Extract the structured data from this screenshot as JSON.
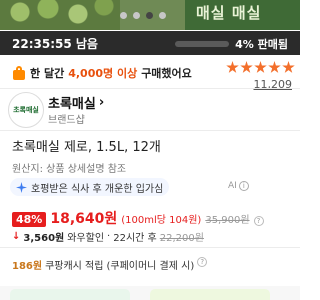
{
  "banner": {
    "text": "매실 매실",
    "carousel_dots": 4,
    "active_dot": 3
  },
  "timer": {
    "countdown": "22:35:55 남음",
    "sold_label": "4% 판매됨",
    "sold_fraction": 0.04
  },
  "social_proof": {
    "icon": "shopping-bag-icon",
    "prefix": "한 달간",
    "count": "4,000명 이상",
    "suffix": "구매했어요"
  },
  "rating": {
    "stars": 5,
    "review_count": "11,209"
  },
  "brand": {
    "logo_text": "초록매실",
    "name": "초록매실",
    "chevron": "›",
    "sub": "브랜드샵"
  },
  "product": {
    "title": "초록매실 제로, 1.5L, 12개",
    "origin": "원산지: 상품 상세설명 참조"
  },
  "ai_summary": {
    "icon": "sparkle-icon",
    "text": "호평받은 식사 후 개운한 입가심",
    "tag": "AI",
    "info_icon": "i"
  },
  "price": {
    "discount": "48%",
    "value": "18,640원",
    "unit_price": "(100ml당 104원)",
    "original": "35,900원",
    "q": "?"
  },
  "wow": {
    "arrow": "↓",
    "amount": "3,560원",
    "label": "와우할인",
    "separator": "·",
    "period": "22시간 후",
    "original": "22,200원"
  },
  "cash": {
    "amount": "186원",
    "label": "쿠팡캐시 적립",
    "note": "(쿠페이머니 결제 시)",
    "q": "?"
  },
  "colors": {
    "accent_red": "#e61e1e",
    "star_orange": "#f36f2b",
    "cash_gold": "#c9771c",
    "highlight_orange": "#e8500d"
  }
}
